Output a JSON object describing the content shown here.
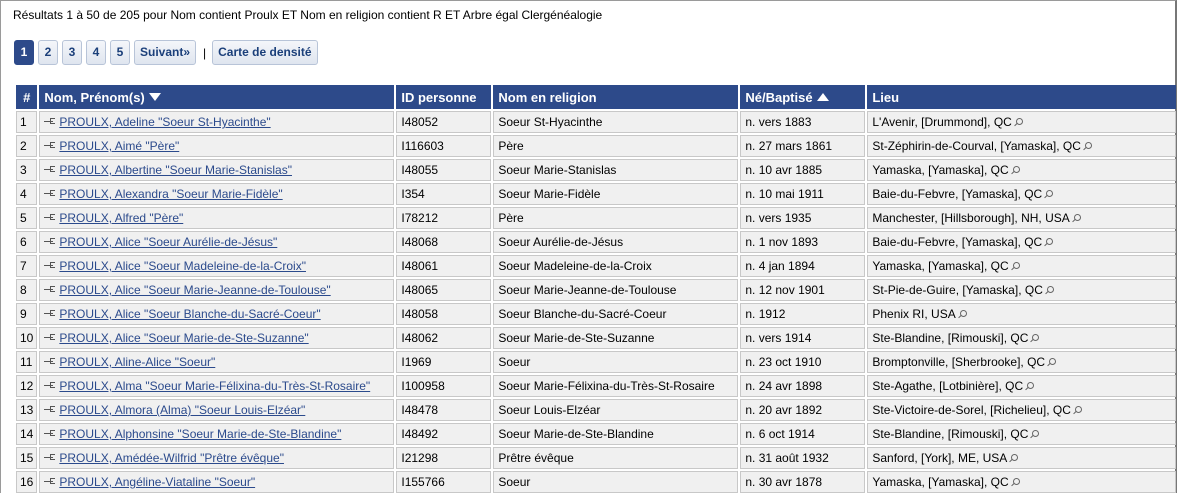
{
  "summary": "Résultats 1 à 50 de 205 pour Nom contient Proulx ET Nom en religion contient R ET Arbre égal Clergénéalogie",
  "pagination": {
    "pages": [
      "1",
      "2",
      "3",
      "4",
      "5"
    ],
    "active": "1",
    "next_label": "Suivant»",
    "separator": "|",
    "density_label": "Carte de densité"
  },
  "table": {
    "headers": {
      "num": "#",
      "name": "Nom, Prénom(s)",
      "id": "ID personne",
      "religion": "Nom en religion",
      "born": "Né/Baptisé",
      "place": "Lieu"
    },
    "sort": {
      "name": "desc",
      "born": "asc"
    },
    "rows": [
      {
        "num": "1",
        "name": "PROULX, Adeline \"Soeur St-Hyacinthe\"",
        "id": "I48052",
        "religion": "Soeur St-Hyacinthe",
        "born": "n. vers 1883",
        "place": "L'Avenir, [Drummond], QC"
      },
      {
        "num": "2",
        "name": "PROULX, Aimé \"Père\"",
        "id": "I116603",
        "religion": "Père",
        "born": "n. 27 mars 1861",
        "place": "St-Zéphirin-de-Courval, [Yamaska], QC"
      },
      {
        "num": "3",
        "name": "PROULX, Albertine \"Soeur Marie-Stanislas\"",
        "id": "I48055",
        "religion": "Soeur Marie-Stanislas",
        "born": "n. 10 avr 1885",
        "place": "Yamaska, [Yamaska], QC"
      },
      {
        "num": "4",
        "name": "PROULX, Alexandra \"Soeur Marie-Fidèle\"",
        "id": "I354",
        "religion": "Soeur Marie-Fidèle",
        "born": "n. 10 mai 1911",
        "place": "Baie-du-Febvre, [Yamaska], QC"
      },
      {
        "num": "5",
        "name": "PROULX, Alfred \"Père\"",
        "id": "I78212",
        "religion": "Père",
        "born": "n. vers 1935",
        "place": "Manchester, [Hillsborough], NH, USA"
      },
      {
        "num": "6",
        "name": "PROULX, Alice \"Soeur Aurélie-de-Jésus\"",
        "id": "I48068",
        "religion": "Soeur Aurélie-de-Jésus",
        "born": "n. 1 nov 1893",
        "place": "Baie-du-Febvre, [Yamaska], QC"
      },
      {
        "num": "7",
        "name": "PROULX, Alice \"Soeur Madeleine-de-la-Croix\"",
        "id": "I48061",
        "religion": "Soeur Madeleine-de-la-Croix",
        "born": "n. 4 jan 1894",
        "place": "Yamaska, [Yamaska], QC"
      },
      {
        "num": "8",
        "name": "PROULX, Alice \"Soeur Marie-Jeanne-de-Toulouse\"",
        "id": "I48065",
        "religion": "Soeur Marie-Jeanne-de-Toulouse",
        "born": "n. 12 nov 1901",
        "place": "St-Pie-de-Guire, [Yamaska], QC"
      },
      {
        "num": "9",
        "name": "PROULX, Alice \"Soeur Blanche-du-Sacré-Coeur\"",
        "id": "I48058",
        "religion": "Soeur Blanche-du-Sacré-Coeur",
        "born": "n. 1912",
        "place": "Phenix RI, USA"
      },
      {
        "num": "10",
        "name": "PROULX, Alice \"Soeur Marie-de-Ste-Suzanne\"",
        "id": "I48062",
        "religion": "Soeur Marie-de-Ste-Suzanne",
        "born": "n. vers 1914",
        "place": "Ste-Blandine, [Rimouski], QC"
      },
      {
        "num": "11",
        "name": "PROULX, Aline-Alice \"Soeur\"",
        "id": "I1969",
        "religion": "Soeur",
        "born": "n. 23 oct 1910",
        "place": "Bromptonville, [Sherbrooke], QC"
      },
      {
        "num": "12",
        "name": "PROULX, Alma \"Soeur Marie-Félixina-du-Très-St-Rosaire\"",
        "id": "I100958",
        "religion": "Soeur Marie-Félixina-du-Très-St-Rosaire",
        "born": "n. 24 avr 1898",
        "place": "Ste-Agathe, [Lotbinière], QC"
      },
      {
        "num": "13",
        "name": "PROULX, Almora (Alma) \"Soeur Louis-Elzéar\"",
        "id": "I48478",
        "religion": "Soeur Louis-Elzéar",
        "born": "n. 20 avr 1892",
        "place": "Ste-Victoire-de-Sorel, [Richelieu], QC"
      },
      {
        "num": "14",
        "name": "PROULX, Alphonsine \"Soeur Marie-de-Ste-Blandine\"",
        "id": "I48492",
        "religion": "Soeur Marie-de-Ste-Blandine",
        "born": "n. 6 oct 1914",
        "place": "Ste-Blandine, [Rimouski], QC"
      },
      {
        "num": "15",
        "name": "PROULX, Amédée-Wilfrid \"Prêtre évêque\"",
        "id": "I21298",
        "religion": "Prêtre évêque",
        "born": "n. 31 août 1932",
        "place": "Sanford, [York], ME, USA"
      },
      {
        "num": "16",
        "name": "PROULX, Angéline-Viataline \"Soeur\"",
        "id": "I155766",
        "religion": "Soeur",
        "born": "n. 30 avr 1878",
        "place": "Yamaska, [Yamaska], QC"
      }
    ]
  },
  "icons": {
    "tree": "family-tree-icon",
    "place": "magnifier-icon",
    "sort_desc": "sort-down-icon",
    "sort_asc": "sort-up-icon"
  },
  "colors": {
    "header_bg": "#2d4a8a",
    "link": "#2b4a8c",
    "cell_bg": "#f0f0f0"
  }
}
